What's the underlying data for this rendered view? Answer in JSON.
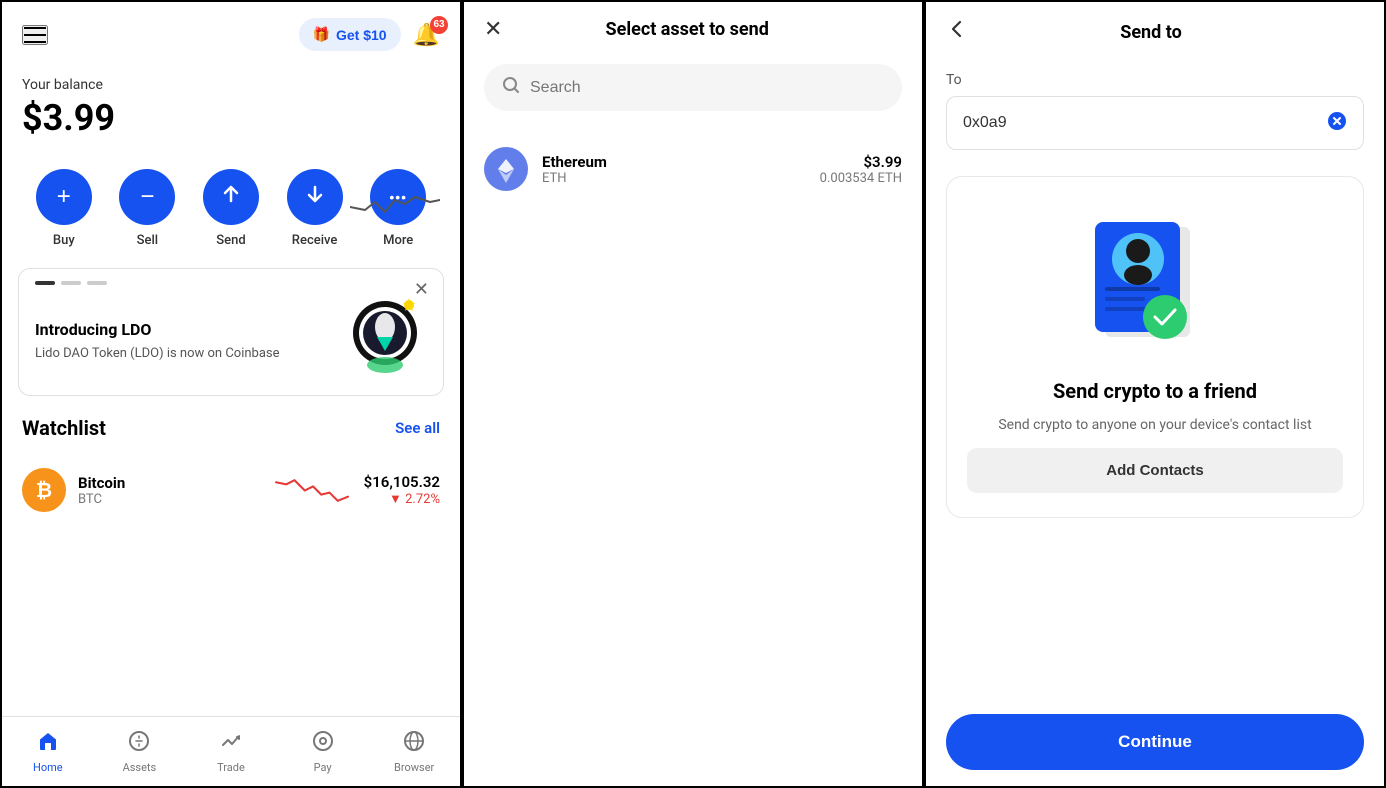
{
  "panel1": {
    "header": {
      "get_money_label": "Get $10",
      "notification_count": "63"
    },
    "balance": {
      "label": "Your balance",
      "amount": "$3.99"
    },
    "actions": [
      {
        "label": "Buy",
        "icon": "+"
      },
      {
        "label": "Sell",
        "icon": "−"
      },
      {
        "label": "Send",
        "icon": "↑"
      },
      {
        "label": "Receive",
        "icon": "↓"
      },
      {
        "label": "More",
        "icon": "•••"
      }
    ],
    "promo": {
      "title": "Introducing LDO",
      "subtitle": "Lido DAO Token (LDO) is now on Coinbase"
    },
    "watchlist": {
      "title": "Watchlist",
      "see_all": "See all",
      "items": [
        {
          "name": "Bitcoin",
          "symbol": "BTC",
          "price": "$16,105.32",
          "change": "▼ 2.72%"
        }
      ]
    },
    "nav": [
      {
        "label": "Home",
        "active": true
      },
      {
        "label": "Assets",
        "active": false
      },
      {
        "label": "Trade",
        "active": false
      },
      {
        "label": "Pay",
        "active": false
      },
      {
        "label": "Browser",
        "active": false
      }
    ]
  },
  "panel2": {
    "title": "Select asset to send",
    "search_placeholder": "Search",
    "assets": [
      {
        "name": "Ethereum",
        "symbol": "ETH",
        "usd_value": "$3.99",
        "crypto_value": "0.003534 ETH"
      }
    ]
  },
  "panel3": {
    "title": "Send to",
    "to_label": "To",
    "address_value": "0x0a9",
    "friend_card": {
      "title": "Send crypto to a friend",
      "subtitle": "Send crypto to anyone on your device's contact list",
      "add_contacts_label": "Add Contacts"
    },
    "continue_label": "Continue"
  }
}
